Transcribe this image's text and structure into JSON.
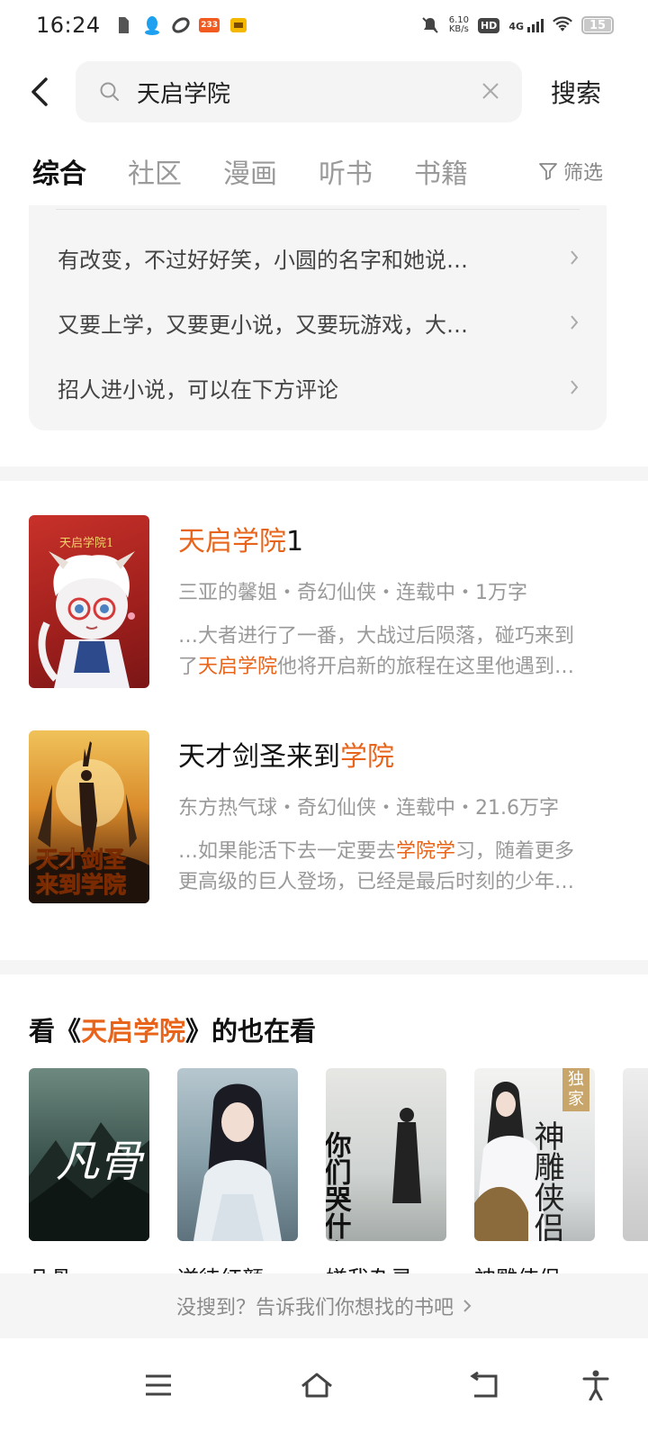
{
  "status_bar": {
    "time": "16:24",
    "net_speed_value": "6.10",
    "net_speed_unit": "KB/s",
    "hd": "HD",
    "signal": "4G",
    "battery": "15",
    "badge_233": "233"
  },
  "search": {
    "query": "天启学院",
    "submit_label": "搜索"
  },
  "tabs": [
    "综合",
    "社区",
    "漫画",
    "听书",
    "书籍"
  ],
  "filter_label": "筛选",
  "topics": [
    "有改变，不过好好笑，小圆的名字和她说…",
    "又要上学，又要更小说，又要玩游戏，大…",
    "招人进小说，可以在下方评论"
  ],
  "books": [
    {
      "title_hl": "天启学院",
      "title_rest": "1",
      "meta": "三亚的馨姐・奇幻仙侠・连载中・1万字",
      "desc1": "…大者进行了一番，大战过后陨落，碰巧来到",
      "desc2_pre": "了",
      "desc2_hl": "天启学院",
      "desc2_post": "他将开启新的旅程在这里他遇到…",
      "cover_text": "天启学院1"
    },
    {
      "title_pre": "天才剑圣来到",
      "title_hl": "学院",
      "meta": "东方热气球・奇幻仙侠・连载中・21.6万字",
      "desc1_pre": "…如果能活下去一定要去",
      "desc1_hl": "学院学",
      "desc1_post": "习，随着更多",
      "desc2": "更高级的巨人登场，已经是最后时刻的少年…",
      "cover_line1": "天才剑圣",
      "cover_line2": "来到学院"
    }
  ],
  "also_watching": {
    "prefix": "看《",
    "hl": "天启学院",
    "suffix": "》的也在看",
    "items": [
      {
        "name": "凡骨",
        "cover_text": "凡骨"
      },
      {
        "name": "逆徒红颜"
      },
      {
        "name": "嫌我杂灵",
        "cover_text": "你们哭什么"
      },
      {
        "name": "神雕侠侣",
        "tag": "独家",
        "cover_text": "神雕侠侣"
      }
    ]
  },
  "feedback": "没搜到？告诉我们你想找的书吧",
  "colors": {
    "highlight": "#e8641b",
    "muted": "#999999",
    "card_bg": "#f5f5f5"
  }
}
